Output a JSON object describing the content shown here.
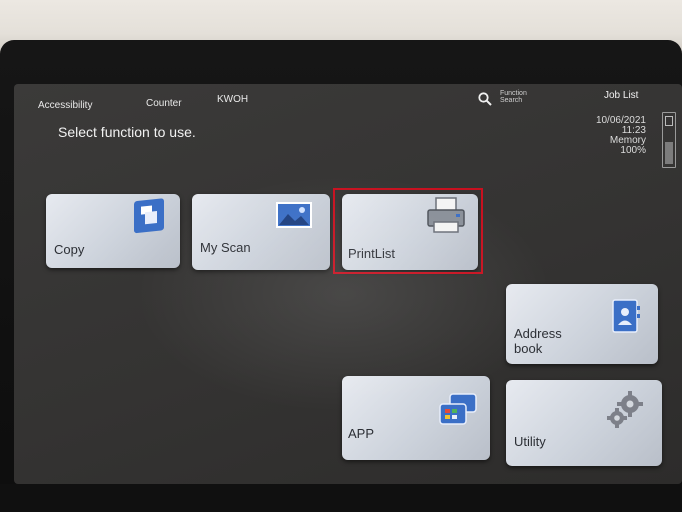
{
  "header": {
    "accessibility": "Accessibility",
    "counter": "Counter",
    "user": "KWOH",
    "function_search": [
      "Function",
      "Search"
    ],
    "job_list": "Job List",
    "title": "Select function to use."
  },
  "status": {
    "date": "10/06/2021",
    "time": "11:23",
    "memory_label": "Memory",
    "memory_value": "100%"
  },
  "tiles": {
    "copy": "Copy",
    "my_scan": "My Scan",
    "print_list": "PrintList",
    "address_book": [
      "Address",
      "book"
    ],
    "app": "APP",
    "utility": "Utility"
  },
  "colors": {
    "highlight": "#c8101f",
    "icon_blue": "#3b6fc6"
  },
  "icons": [
    "search-icon",
    "copy-icon",
    "scan-icon",
    "printer-icon",
    "address-book-icon",
    "app-icon",
    "gear-icon",
    "memory-icon"
  ]
}
